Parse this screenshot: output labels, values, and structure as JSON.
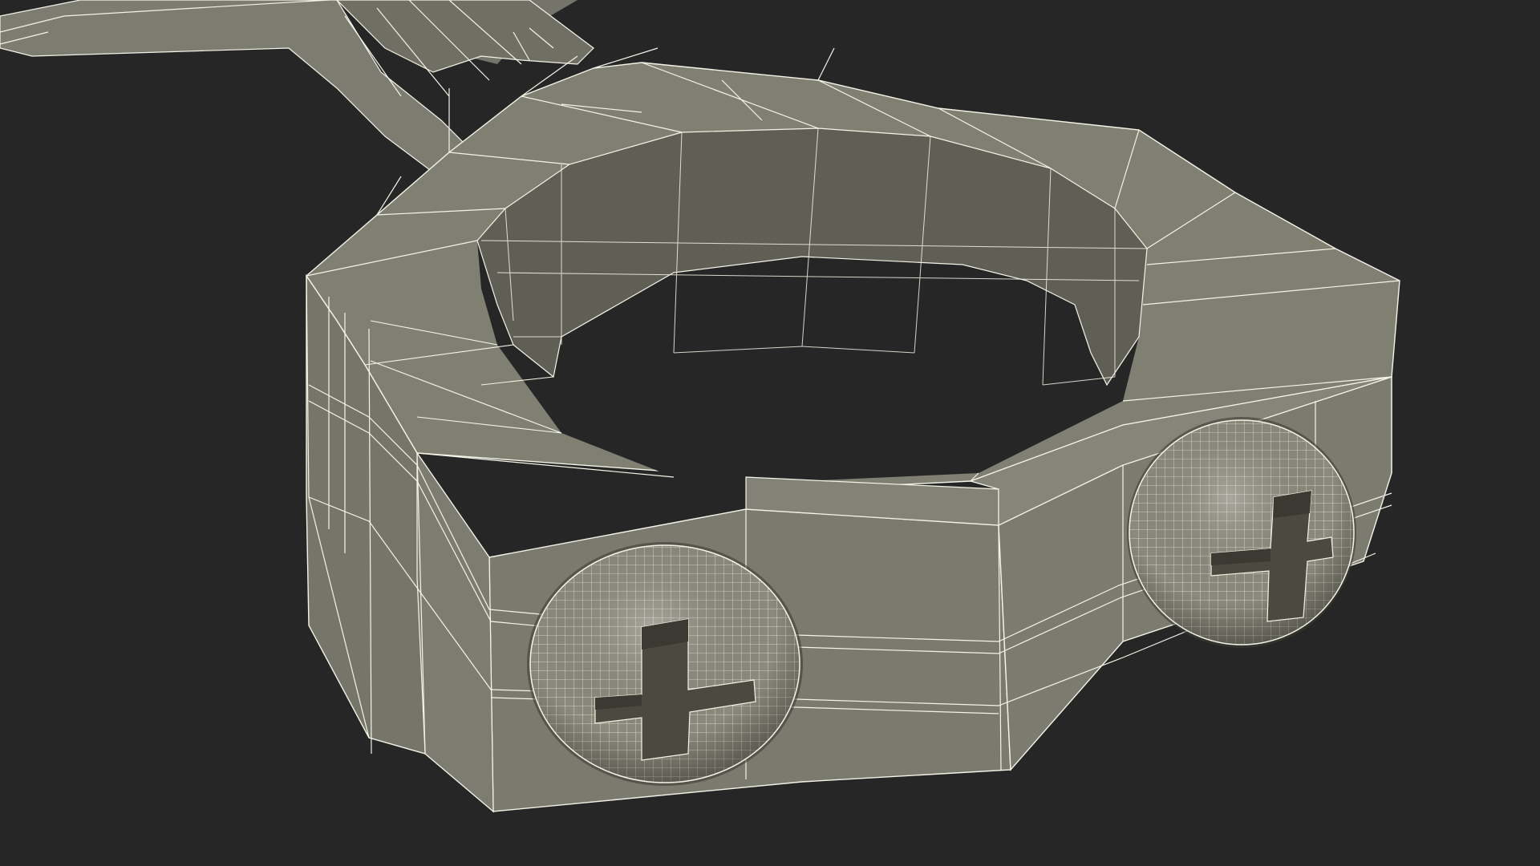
{
  "scene": {
    "subject": "connecting-rod-big-end-wireframe",
    "colors": {
      "background": "#262626",
      "surface_top": "#7f7f72",
      "surface_front": "#7a7a6e",
      "surface_inner": "#626257",
      "surface_dark": "#555549",
      "wire": "#f4f4e8",
      "bolt_head": "#8b8b7d",
      "bolt_slot": "#4a4a40"
    },
    "icons": [
      "bolt-head-icon",
      "phillips-slot-icon"
    ]
  }
}
